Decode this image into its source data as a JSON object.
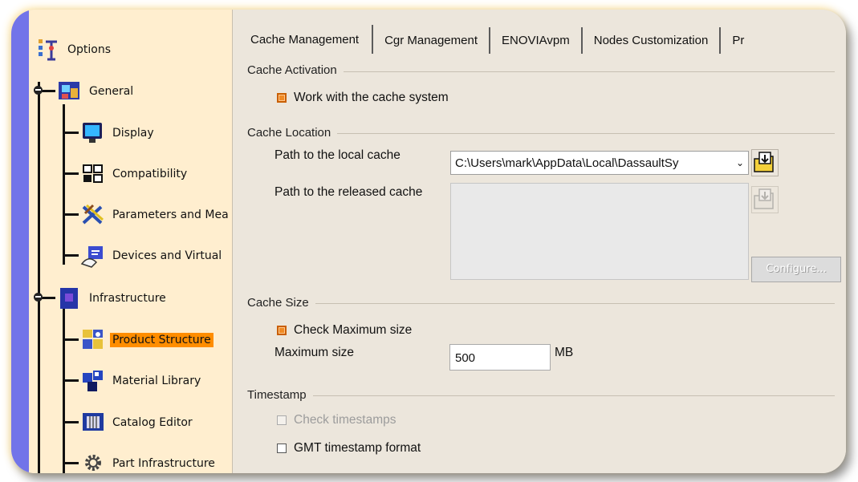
{
  "tree": {
    "items": [
      {
        "label": "Options",
        "icon": "options-tree-icon"
      },
      {
        "label": "General",
        "icon": "general-icon"
      },
      {
        "label": "Display",
        "icon": "display-monitor-icon"
      },
      {
        "label": "Compatibility",
        "icon": "compatibility-icon"
      },
      {
        "label": "Parameters and Mea",
        "icon": "parameters-measure-icon"
      },
      {
        "label": "Devices and Virtual",
        "icon": "devices-virtual-icon"
      },
      {
        "label": "Infrastructure",
        "icon": "infrastructure-icon"
      },
      {
        "label": "Product Structure",
        "icon": "product-structure-icon",
        "selected": true
      },
      {
        "label": "Material Library",
        "icon": "material-library-icon"
      },
      {
        "label": "Catalog Editor",
        "icon": "catalog-editor-icon"
      },
      {
        "label": "Part Infrastructure",
        "icon": "gear-icon"
      }
    ],
    "selected_color": "#ff8d00"
  },
  "tabs": [
    {
      "label": "Cache Management",
      "active": true
    },
    {
      "label": "Cgr Management"
    },
    {
      "label": "ENOVIAvpm"
    },
    {
      "label": "Nodes Customization"
    },
    {
      "label": "Pr"
    }
  ],
  "sections": {
    "activation": {
      "title": "Cache Activation",
      "work_with_cache": {
        "label": "Work with the cache system",
        "checked": true
      }
    },
    "location": {
      "title": "Cache Location",
      "local_label": "Path to the local cache",
      "local_value": "C:\\Users\\mark\\AppData\\Local\\DassaultSy",
      "released_label": "Path to the released cache",
      "configure_label": "Configure..."
    },
    "size": {
      "title": "Cache Size",
      "check_max": {
        "label": "Check Maximum size",
        "checked": true
      },
      "max_label": "Maximum size",
      "max_value": "500",
      "unit": "MB"
    },
    "timestamp": {
      "title": "Timestamp",
      "check_timestamps": {
        "label": "Check timestamps",
        "checked": false,
        "disabled": true
      },
      "gmt_format": {
        "label": "GMT timestamp format",
        "checked": false
      }
    }
  },
  "colors": {
    "tree_bg": "#ffeecf",
    "tree_bar": "#7274e9",
    "panel_bg": "#ece6dc",
    "check_orange": "#f08a24"
  }
}
